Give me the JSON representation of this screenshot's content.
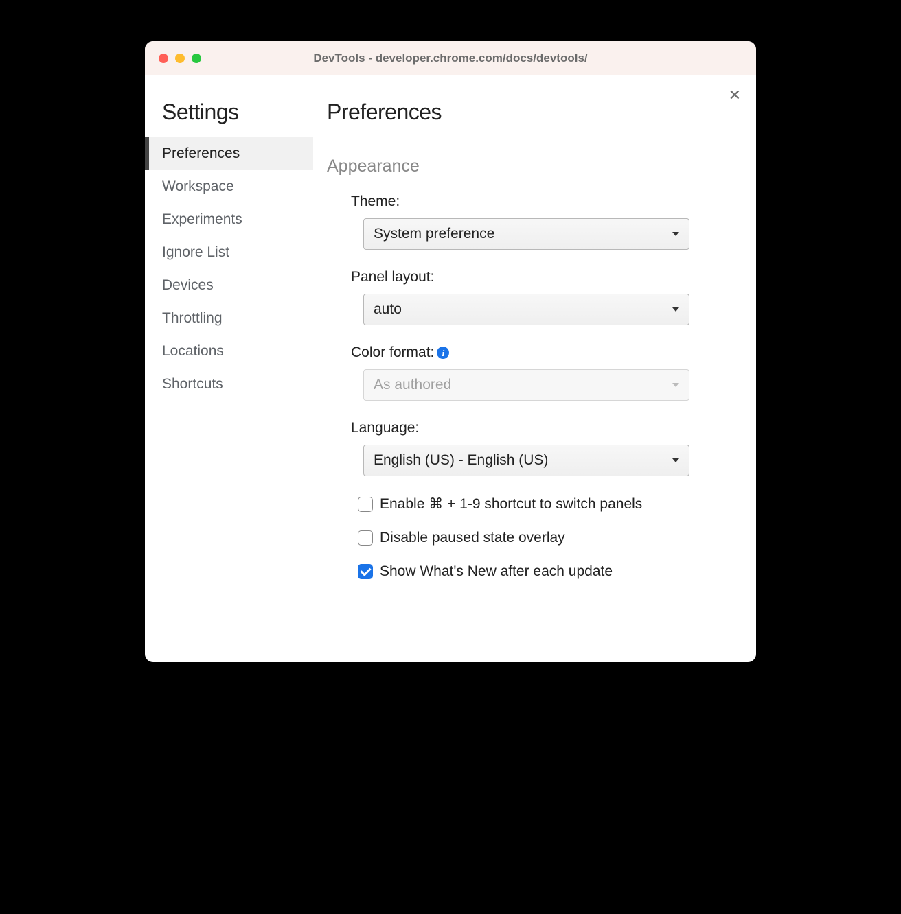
{
  "window": {
    "title": "DevTools - developer.chrome.com/docs/devtools/"
  },
  "sidebar": {
    "title": "Settings",
    "items": [
      {
        "label": "Preferences",
        "active": true
      },
      {
        "label": "Workspace",
        "active": false
      },
      {
        "label": "Experiments",
        "active": false
      },
      {
        "label": "Ignore List",
        "active": false
      },
      {
        "label": "Devices",
        "active": false
      },
      {
        "label": "Throttling",
        "active": false
      },
      {
        "label": "Locations",
        "active": false
      },
      {
        "label": "Shortcuts",
        "active": false
      }
    ]
  },
  "main": {
    "title": "Preferences",
    "section": "Appearance",
    "theme": {
      "label": "Theme:",
      "value": "System preference"
    },
    "panel_layout": {
      "label": "Panel layout:",
      "value": "auto"
    },
    "color_format": {
      "label": "Color format:",
      "value": "As authored",
      "disabled": true,
      "info": true
    },
    "language": {
      "label": "Language:",
      "value": "English (US) - English (US)"
    },
    "checkboxes": [
      {
        "label": "Enable ⌘ + 1-9 shortcut to switch panels",
        "checked": false
      },
      {
        "label": "Disable paused state overlay",
        "checked": false
      },
      {
        "label": "Show What's New after each update",
        "checked": true
      }
    ]
  }
}
